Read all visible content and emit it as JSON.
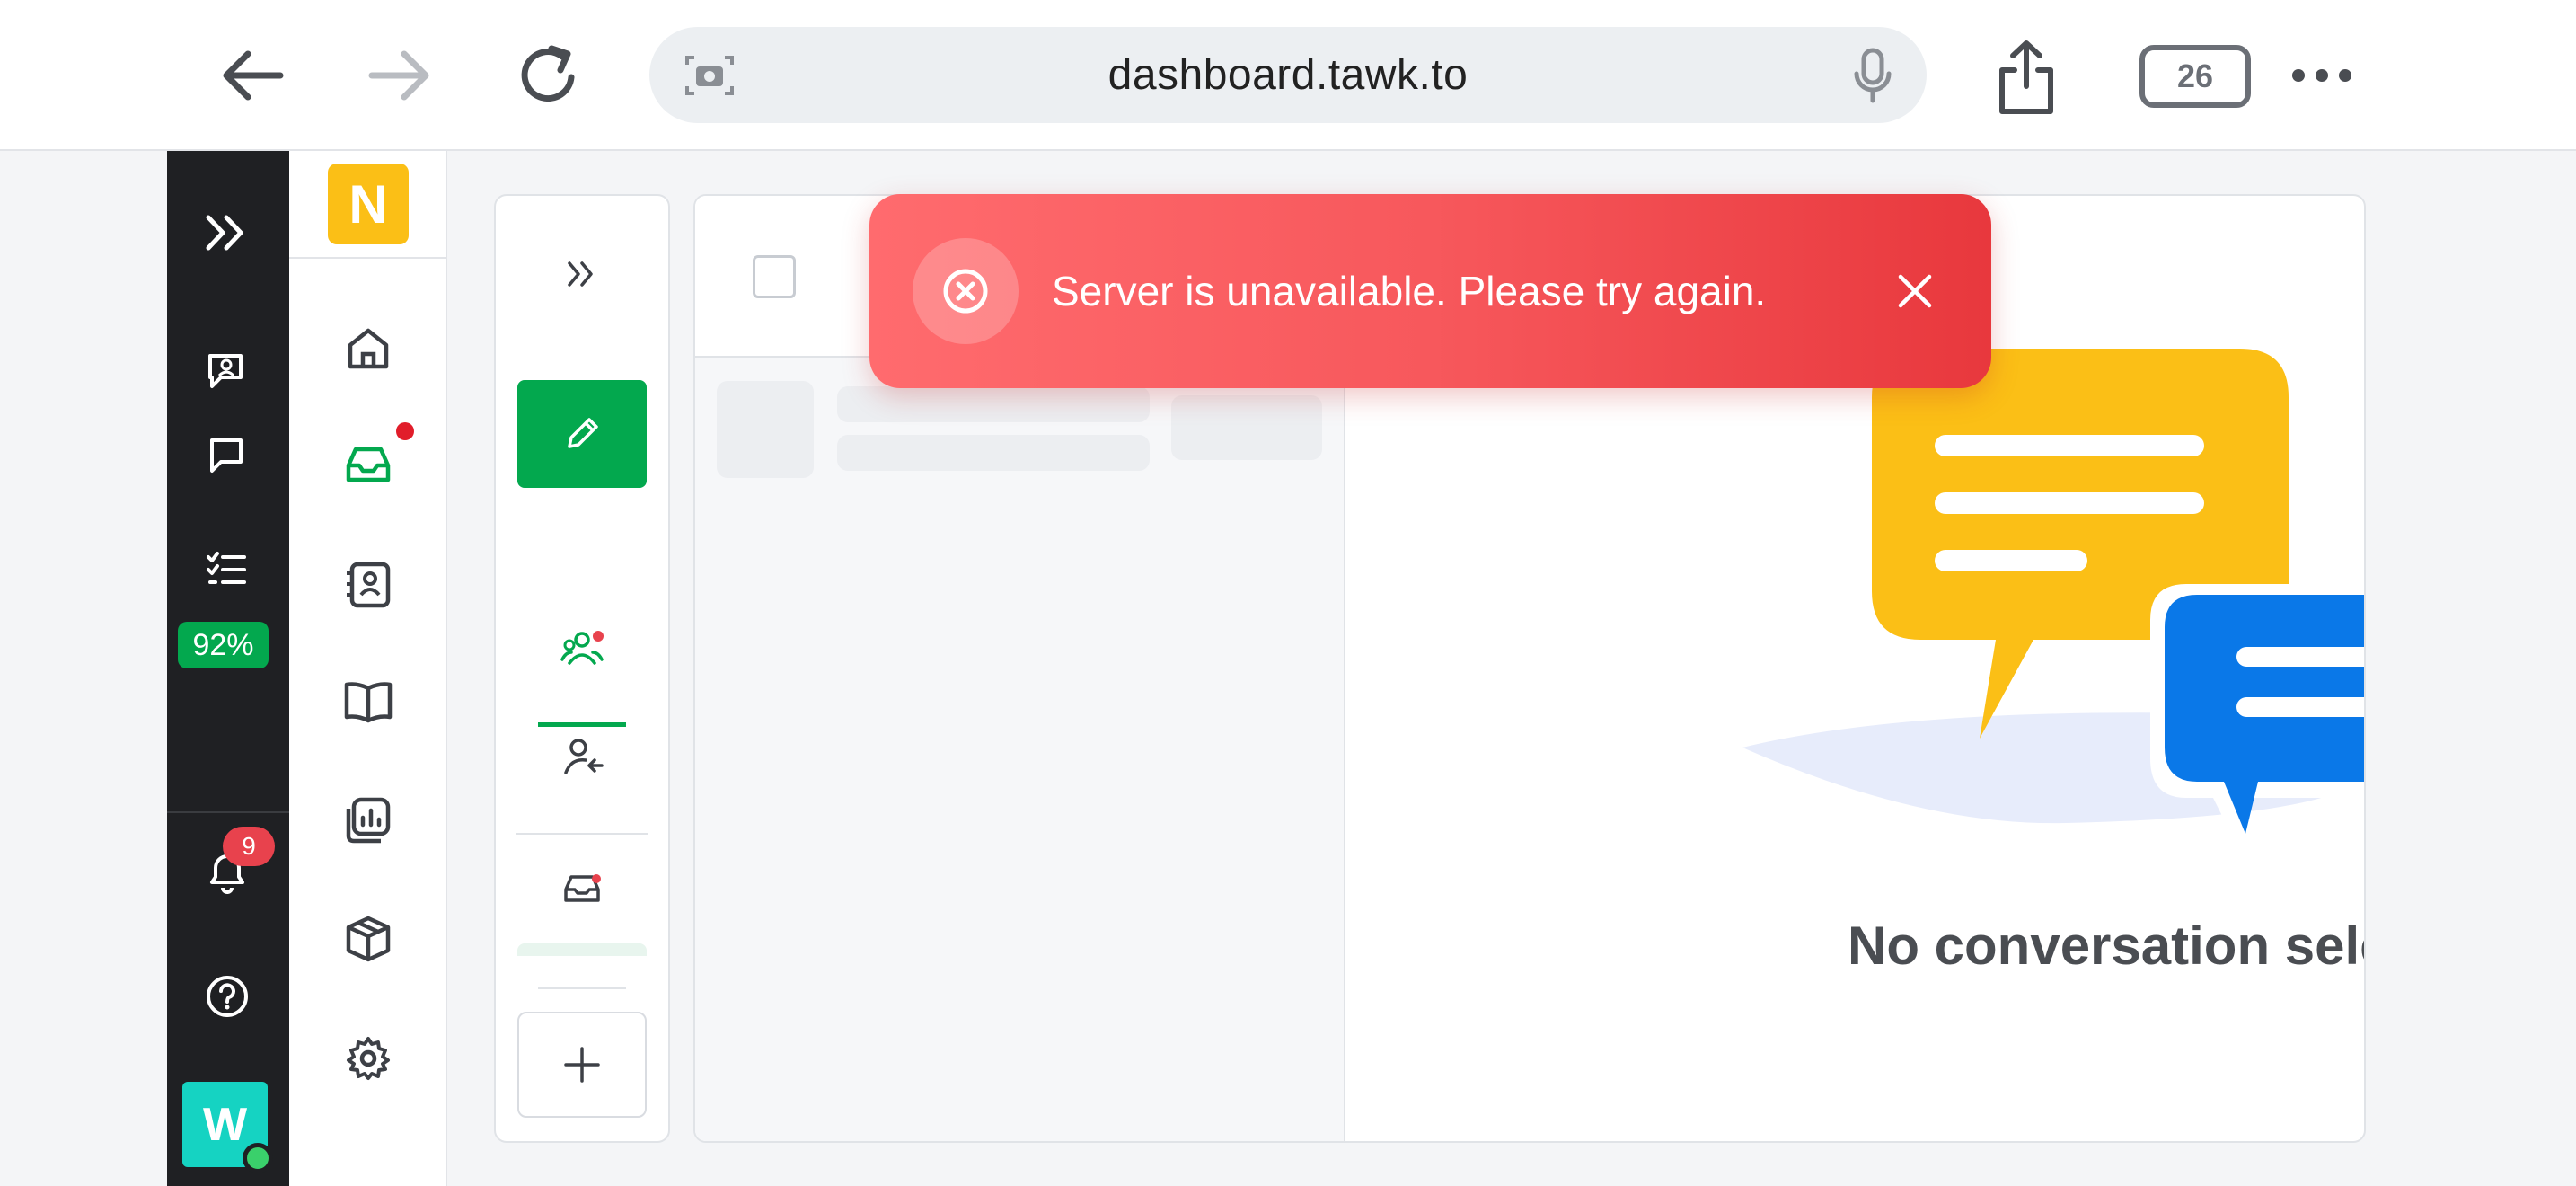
{
  "browser": {
    "url": "dashboard.tawk.to",
    "tab_count": "26"
  },
  "rail": {
    "progress": "92%",
    "notification_count": "9",
    "user_initial": "W"
  },
  "sidebar": {
    "workspace_initial": "N"
  },
  "empty_state": {
    "title": "No conversation selec"
  },
  "toast": {
    "message": "Server is unavailable. Please try again."
  },
  "colors": {
    "brand_green": "#03a84e",
    "rail_bg": "#1f2023",
    "toast_red": "#f7585c",
    "chat_yellow": "#fbbf16",
    "chat_blue": "#0a78e8"
  }
}
